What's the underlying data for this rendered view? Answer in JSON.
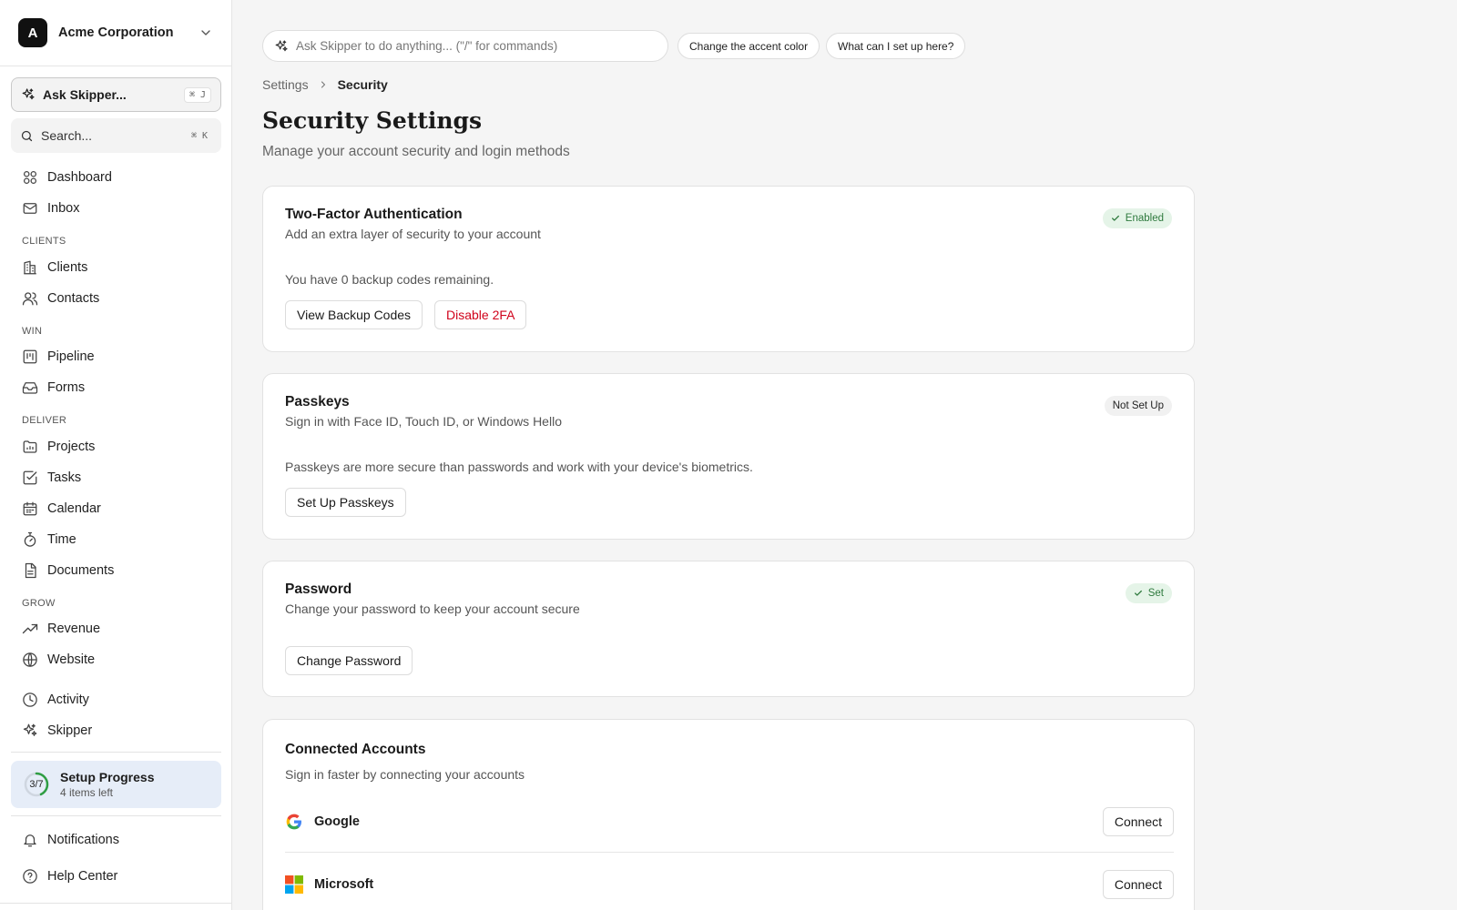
{
  "org": {
    "avatar_letter": "A",
    "name": "Acme Corporation"
  },
  "sidebar": {
    "ask_label": "Ask Skipper...",
    "ask_shortcut": "⌘ J",
    "search_label": "Search...",
    "search_shortcut": "⌘ K",
    "top_items": [
      {
        "label": "Dashboard",
        "icon": "dashboard-icon"
      },
      {
        "label": "Inbox",
        "icon": "mail-icon"
      }
    ],
    "sections": [
      {
        "title": "CLIENTS",
        "items": [
          {
            "label": "Clients",
            "icon": "building-icon"
          },
          {
            "label": "Contacts",
            "icon": "users-icon"
          }
        ]
      },
      {
        "title": "WIN",
        "items": [
          {
            "label": "Pipeline",
            "icon": "kanban-icon"
          },
          {
            "label": "Forms",
            "icon": "inbox-tray-icon"
          }
        ]
      },
      {
        "title": "DELIVER",
        "items": [
          {
            "label": "Projects",
            "icon": "folder-icon"
          },
          {
            "label": "Tasks",
            "icon": "checkbox-icon"
          },
          {
            "label": "Calendar",
            "icon": "calendar-icon"
          },
          {
            "label": "Time",
            "icon": "stopwatch-icon"
          },
          {
            "label": "Documents",
            "icon": "document-icon"
          }
        ]
      },
      {
        "title": "GROW",
        "items": [
          {
            "label": "Revenue",
            "icon": "trend-up-icon"
          },
          {
            "label": "Website",
            "icon": "globe-icon"
          }
        ]
      }
    ],
    "bottom_items": [
      {
        "label": "Activity",
        "icon": "clock-icon"
      },
      {
        "label": "Skipper",
        "icon": "sparkles-icon"
      }
    ],
    "setup": {
      "progress": "3/7",
      "completed": 3,
      "total": 7,
      "title": "Setup Progress",
      "subtitle": "4 items left"
    },
    "footer_items": [
      {
        "label": "Notifications",
        "icon": "bell-icon"
      },
      {
        "label": "Help Center",
        "icon": "help-circle-icon"
      }
    ]
  },
  "command_bar": {
    "placeholder": "Ask Skipper to do anything... (\"/\" for commands)",
    "chips": [
      "Change the accent color",
      "What can I set up here?"
    ]
  },
  "breadcrumb": {
    "parent": "Settings",
    "current": "Security"
  },
  "page": {
    "title": "Security Settings",
    "subtitle": "Manage your account security and login methods"
  },
  "two_factor": {
    "title": "Two-Factor Authentication",
    "description": "Add an extra layer of security to your account",
    "status": "Enabled",
    "note": "You have 0 backup codes remaining.",
    "view_codes_label": "View Backup Codes",
    "disable_label": "Disable 2FA"
  },
  "passkeys": {
    "title": "Passkeys",
    "description": "Sign in with Face ID, Touch ID, or Windows Hello",
    "status": "Not Set Up",
    "note": "Passkeys are more secure than passwords and work with your device's biometrics.",
    "setup_label": "Set Up Passkeys"
  },
  "password": {
    "title": "Password",
    "description": "Change your password to keep your account secure",
    "status": "Set",
    "change_label": "Change Password"
  },
  "connected_accounts": {
    "title": "Connected Accounts",
    "description": "Sign in faster by connecting your accounts",
    "accounts": [
      {
        "name": "Google",
        "action": "Connect"
      },
      {
        "name": "Microsoft",
        "action": "Connect"
      }
    ]
  },
  "colors": {
    "success_bg": "#e5f4e8",
    "success_text": "#2f7a3e",
    "danger": "#d0021b",
    "setup_bg": "#e6edf8",
    "progress_ring": "#2f9e44"
  }
}
